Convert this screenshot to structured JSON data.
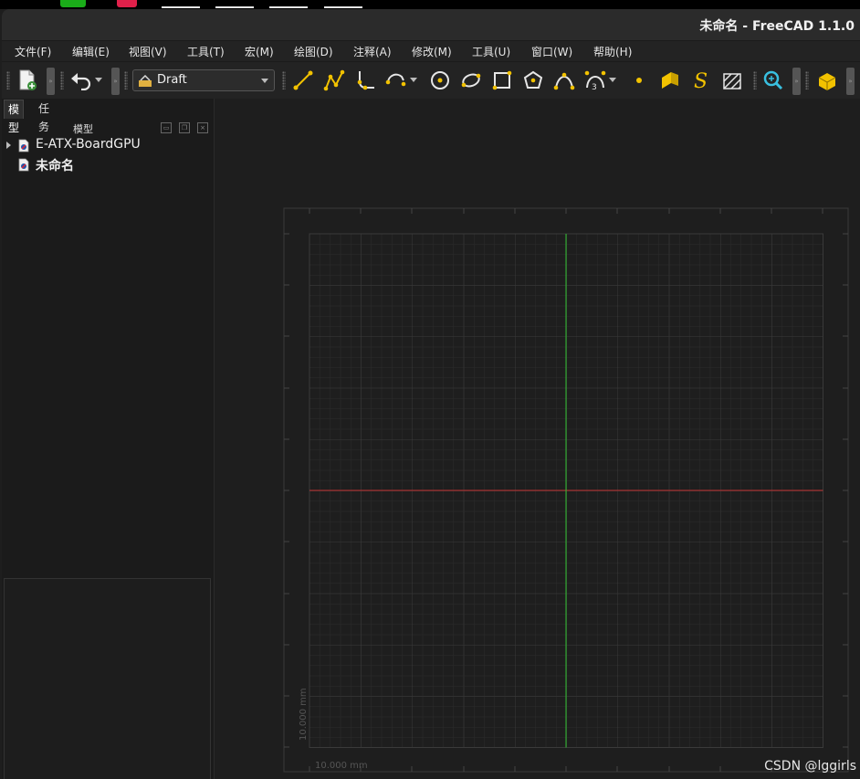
{
  "window": {
    "title": "未命名 - FreeCAD 1.1.0"
  },
  "menu": [
    {
      "label": "文件(F)",
      "name": "menu-file"
    },
    {
      "label": "编辑(E)",
      "name": "menu-edit"
    },
    {
      "label": "视图(V)",
      "name": "menu-view"
    },
    {
      "label": "工具(T)",
      "name": "menu-tools"
    },
    {
      "label": "宏(M)",
      "name": "menu-macro"
    },
    {
      "label": "绘图(D)",
      "name": "menu-drawing"
    },
    {
      "label": "注释(A)",
      "name": "menu-annotation"
    },
    {
      "label": "修改(M)",
      "name": "menu-modify"
    },
    {
      "label": "工具(U)",
      "name": "menu-utilities"
    },
    {
      "label": "窗口(W)",
      "name": "menu-window"
    },
    {
      "label": "帮助(H)",
      "name": "menu-help"
    }
  ],
  "toolbar": {
    "workbench": "Draft",
    "tools": [
      "new-document-icon",
      "undo-icon",
      "line-icon",
      "polyline-icon",
      "fillet-icon",
      "arc-icon",
      "circle-icon",
      "ellipse-icon",
      "rectangle-icon",
      "polygon-icon",
      "bspline-icon",
      "bezier-icon",
      "point-icon",
      "facebinder-icon",
      "shapestring-icon",
      "hatch-icon",
      "zoom-icon",
      "part-icon"
    ]
  },
  "panel": {
    "tabs": [
      "模型",
      "任务"
    ],
    "header": "模型",
    "tree": [
      {
        "label": "E-ATX-BoardGPU",
        "expandable": true,
        "bold": false
      },
      {
        "label": "未命名",
        "expandable": false,
        "bold": true
      }
    ]
  },
  "view": {
    "y_scale_label": "10.000 mm",
    "x_scale_label": "10.000 mm"
  },
  "watermark": "CSDN @lggirls",
  "colors": {
    "x_axis": "#c03030",
    "y_axis": "#30c030",
    "grid_minor": "#2c2c2c",
    "grid_major": "#3a3a3a",
    "accent": "#f2c200"
  }
}
